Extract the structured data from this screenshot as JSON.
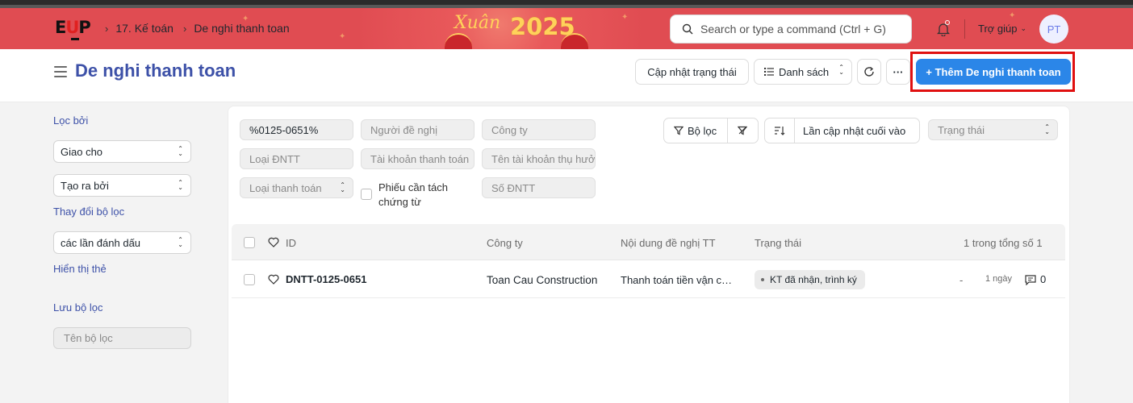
{
  "navbar": {
    "logo_text": "EUP",
    "breadcrumbs": [
      "17. Kế toán",
      "De nghi thanh toan"
    ],
    "banner_year": "2025",
    "search_placeholder": "Search or type a command (Ctrl + G)",
    "help_label": "Trợ giúp",
    "avatar_initials": "PT"
  },
  "page": {
    "title": "De nghi thanh toan",
    "actions": {
      "update_status": "Cập nhật trạng thái",
      "list_view": "Danh sách",
      "more": "···",
      "add_new": "+ Thêm De nghi thanh toan"
    }
  },
  "sidebar": {
    "filter_by": "Lọc bởi",
    "assigned_to": "Giao cho",
    "created_by": "Tạo ra bởi",
    "edit_filters": "Thay đổi bộ lọc",
    "tags": "các lần đánh dấu",
    "show_tags": "Hiển thị thẻ",
    "save_filter": "Lưu bộ lọc",
    "filter_name_placeholder": "Tên bộ lọc"
  },
  "filters": {
    "id_value": "%0125-0651%",
    "requester": "Người đề nghị",
    "company": "Công ty",
    "type": "Loại ĐNTT",
    "account": "Tài khoản thanh toán",
    "beneficiary": "Tên tài khoản thụ hưởng",
    "payment_type": "Loại thanh toán",
    "split_voucher": "Phiếu cần tách chứng từ",
    "number": "Số ĐNTT",
    "filter_button": "Bộ lọc",
    "sort_label": "Lần cập nhật cuối vào",
    "status": "Trạng thái"
  },
  "table": {
    "columns": [
      "ID",
      "Công ty",
      "Nội dung đề nghị TT",
      "Trạng thái"
    ],
    "count_text": "1 trong tổng số 1",
    "rows": [
      {
        "id": "DNTT-0125-0651",
        "company": "Toan Cau Construction",
        "content": "Thanh toán tiền vận c…",
        "status": "KT đã nhận, trình ký",
        "assigned": "-",
        "age": "1 ngày",
        "comments": "0"
      }
    ]
  },
  "colors": {
    "navbar_bg": "#e04c52",
    "primary": "#2b86e8",
    "title": "#3d51a8",
    "highlight": "#e01010"
  }
}
